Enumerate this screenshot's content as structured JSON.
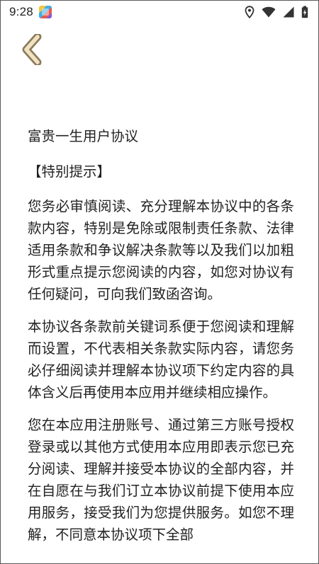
{
  "status_bar": {
    "time": "9:28",
    "icons": [
      "app-notification-icon",
      "location-icon",
      "wifi-icon",
      "signal-icon",
      "battery-icon"
    ]
  },
  "header": {
    "back_icon": "chevron-left-icon",
    "back_color": "#8b7a5c",
    "back_fill": "#f1e3c2"
  },
  "document": {
    "title": "富贵一生用户协议",
    "special_tip": "【特别提示】",
    "paragraphs": [
      "您务必审慎阅读、充分理解本协议中的各条款内容，特别是免除或限制责任条款、法律适用条款和争议解决条款等以及我们以加粗形式重点提示您阅读的内容，如您对协议有任何疑问，可向我们致函咨询。",
      "本协议各条款前关键词系便于您阅读和理解而设置，不代表相关条款实际内容，请您务必仔细阅读并理解本协议项下约定内容的具体含义后再使用本应用并继续相应操作。",
      "您在本应用注册账号、通过第三方账号授权登录或以其他方式使用本应用即表示您已充分阅读、理解并接受本协议的全部内容，并在自愿在与我们订立本协议前提下使用本应用服务，接受我们为您提供服务。如您不理解，不同意本协议项下全部"
    ]
  }
}
